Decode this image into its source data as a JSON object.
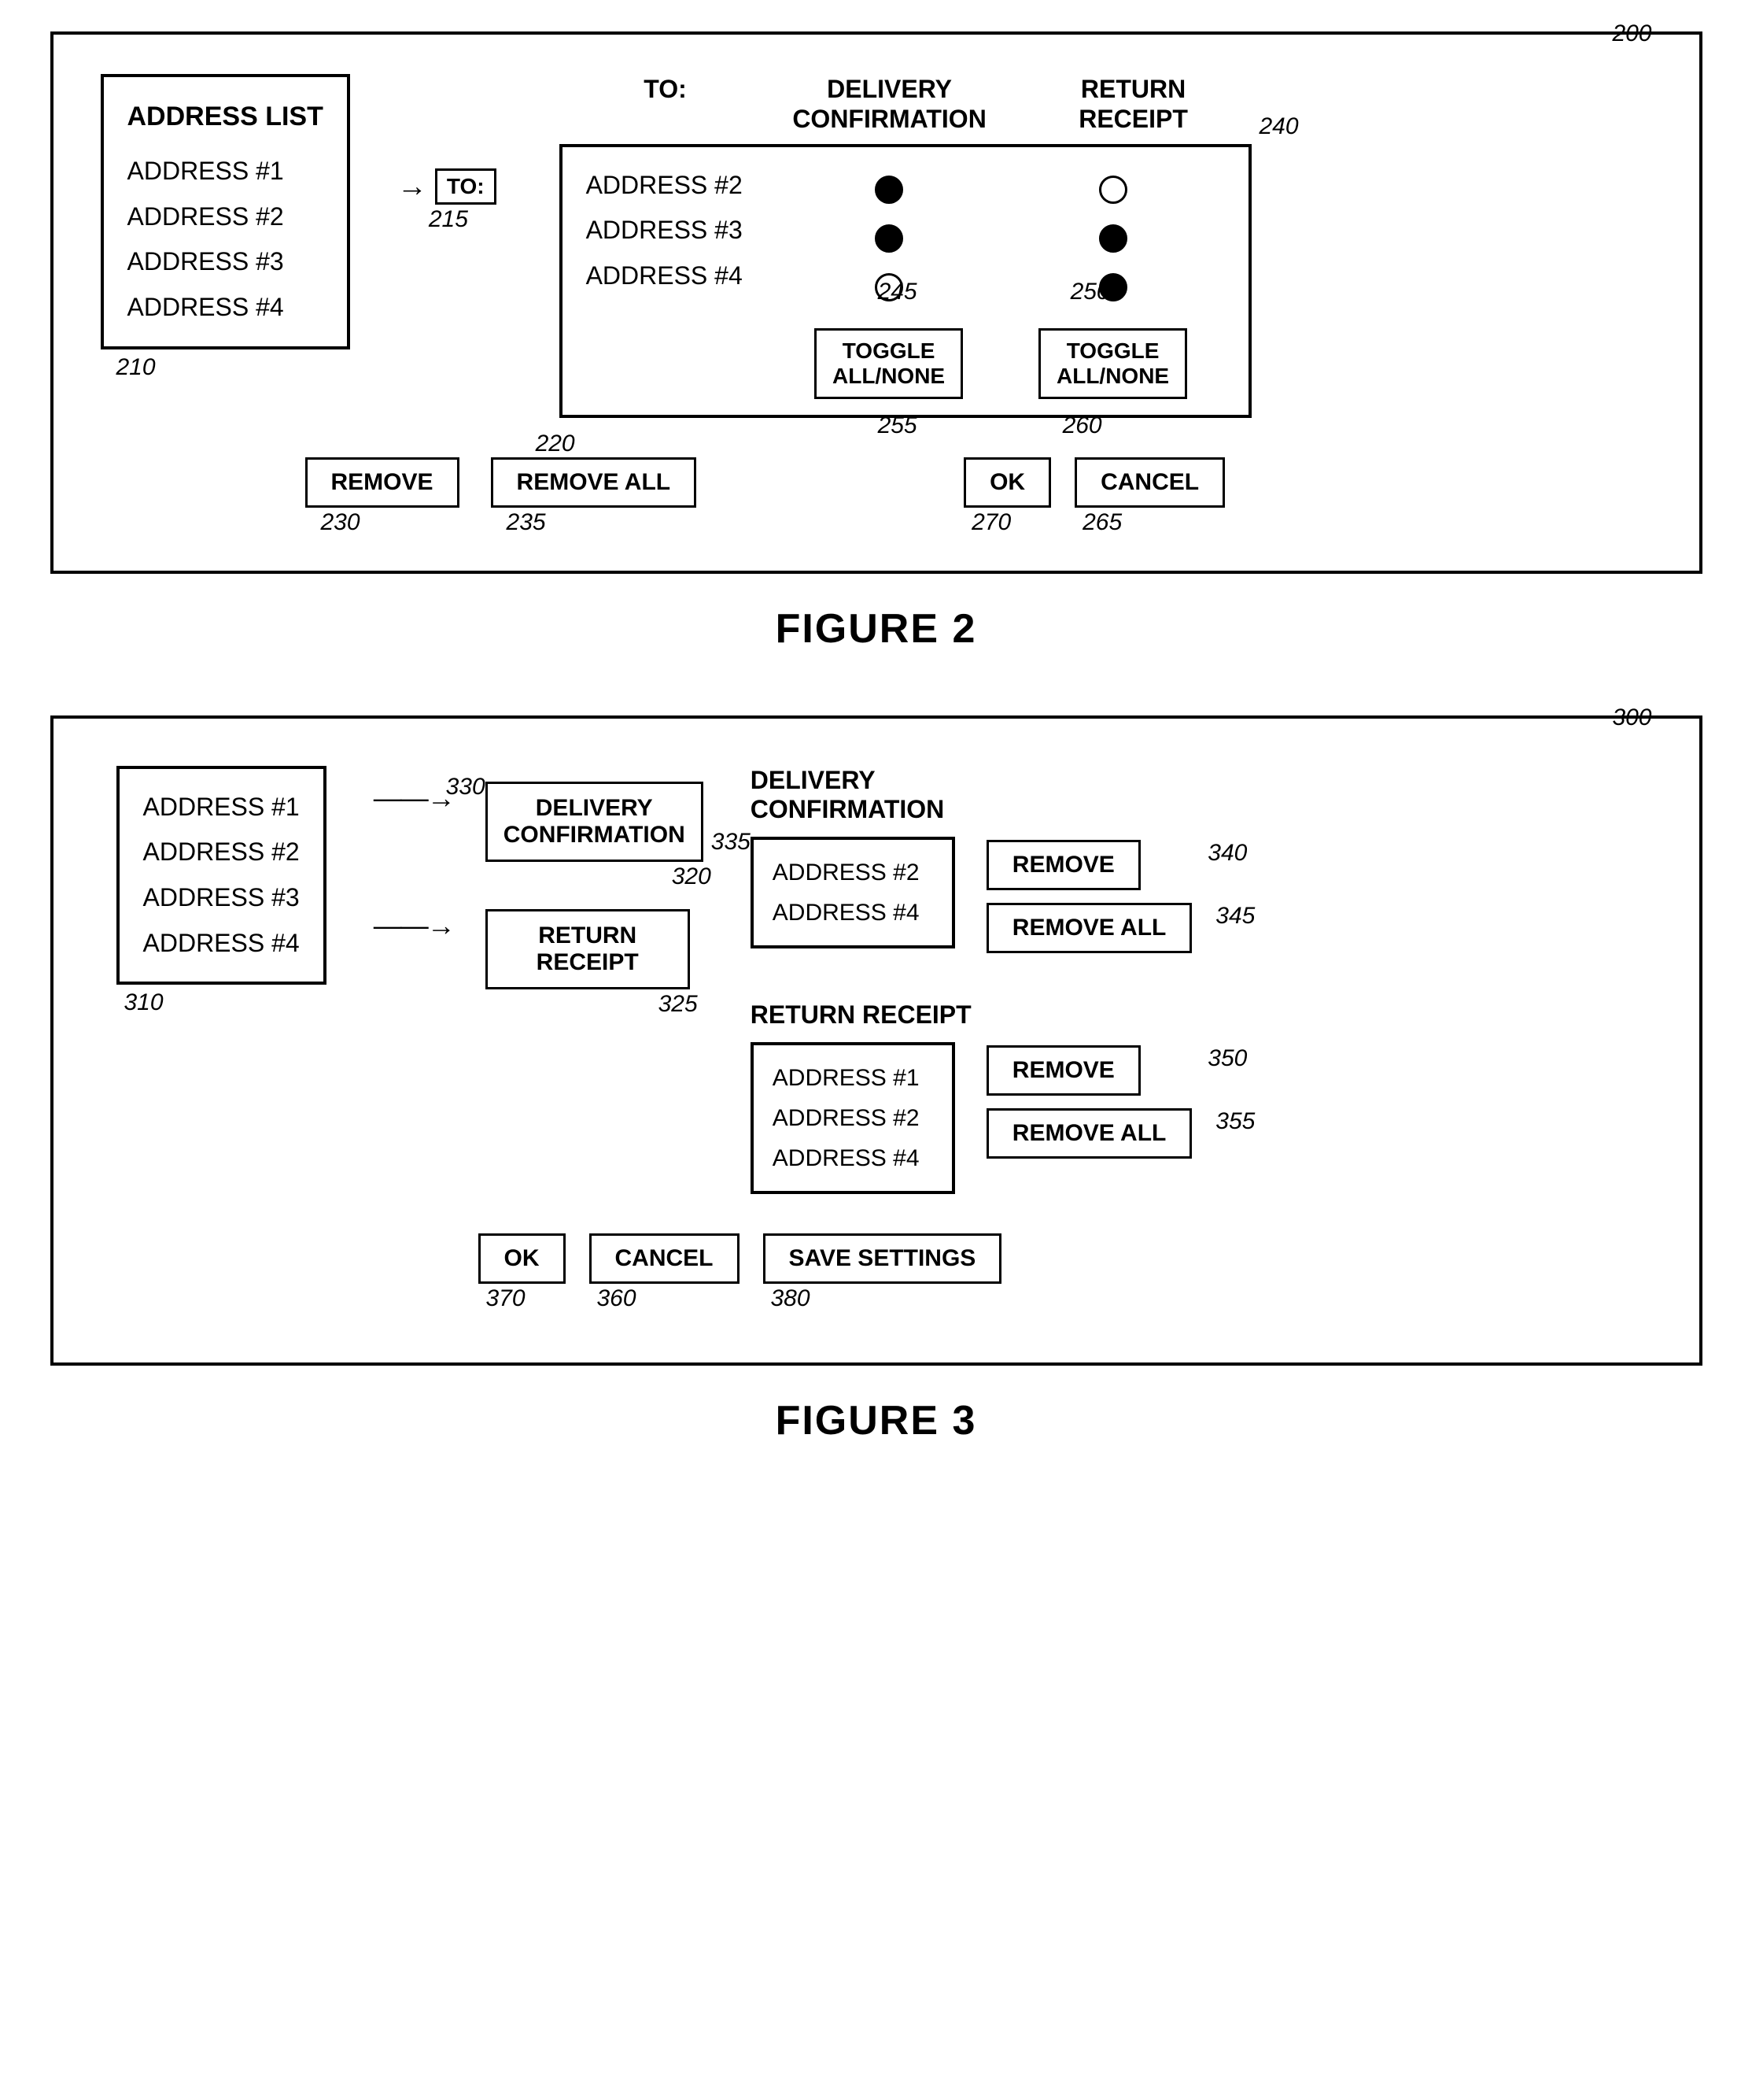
{
  "fig2": {
    "ref_main": "200",
    "title": "FIGURE 2",
    "address_list": {
      "title": "ADDRESS LIST",
      "ref": "210",
      "items": [
        "ADDRESS #1",
        "ADDRESS #2",
        "ADDRESS #3",
        "ADDRESS #4"
      ],
      "ref215": "215"
    },
    "arrow_label": "→",
    "to_button": "TO:",
    "ref220": "220",
    "column_headers": {
      "to": "TO:",
      "delivery": "DELIVERY\nCONFIRMATION",
      "return": "RETURN\nRECEIPT"
    },
    "recipients": {
      "items": [
        "ADDRESS #2",
        "ADDRESS #3",
        "ADDRESS #4"
      ]
    },
    "delivery_indicators": [
      "filled",
      "filled",
      "empty"
    ],
    "return_indicators": [
      "empty",
      "filled",
      "filled"
    ],
    "ref245": "245",
    "ref250": "250",
    "toggle_all_none_1": "TOGGLE\nALL/NONE",
    "toggle_all_none_2": "TOGGLE\nALL/NONE",
    "ref255": "255",
    "ref260": "260",
    "ref240": "240",
    "remove_btn": "REMOVE",
    "remove_all_btn": "REMOVE ALL",
    "ref230": "230",
    "ref235": "235",
    "ok_btn": "OK",
    "cancel_btn": "CANCEL",
    "ref270": "270",
    "ref265": "265"
  },
  "fig3": {
    "ref_main": "300",
    "title": "FIGURE 3",
    "address_list": {
      "ref": "310",
      "items": [
        "ADDRESS #1",
        "ADDRESS #2",
        "ADDRESS #3",
        "ADDRESS #4"
      ]
    },
    "delivery_conf_btn": "DELIVERY\nCONFIRMATION",
    "return_receipt_btn": "RETURN\nRECEIPT",
    "ref320": "320",
    "ref325": "325",
    "ref330": "330",
    "ref335": "335",
    "delivery_group": {
      "title": "DELIVERY\nCONFIRMATION",
      "recipients": [
        "ADDRESS #2",
        "ADDRESS #4"
      ],
      "remove_btn": "REMOVE",
      "remove_all_btn": "REMOVE ALL",
      "ref340": "340",
      "ref345": "345"
    },
    "return_group": {
      "title": "RETURN RECEIPT",
      "recipients": [
        "ADDRESS #1",
        "ADDRESS #2",
        "ADDRESS #4"
      ],
      "remove_btn": "REMOVE",
      "remove_all_btn": "REMOVE ALL",
      "ref350": "350",
      "ref355": "355"
    },
    "ok_btn": "OK",
    "cancel_btn": "CANCEL",
    "save_btn": "SAVE SETTINGS",
    "ref370": "370",
    "ref360": "360",
    "ref380": "380"
  }
}
